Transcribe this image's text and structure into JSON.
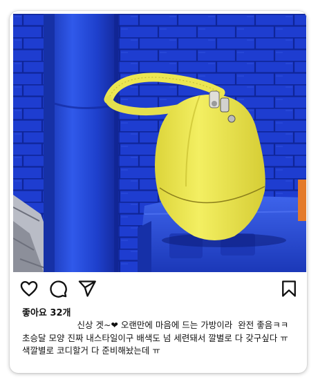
{
  "post": {
    "photo": {
      "alt": "",
      "colors": {
        "wall": "#1e3dd0",
        "bag": "#eeea55",
        "pipe": "#2046d8"
      }
    },
    "actions": {
      "like_icon": "heart-icon",
      "comment_icon": "comment-icon",
      "share_icon": "paper-plane-icon",
      "save_icon": "bookmark-icon"
    },
    "likes_label": "좋아요 32개",
    "caption": "                    신상 겟~❤ 오랜만에 마음에 드는 가방이라  완전 좋음ㅋㅋ\n초승달 모양 진짜 내스타일이구 배색도 넘 세련돼서 깔별로 다 갖구싶다 ㅠ 색깔별로 코디할거 다 준비해놨는데 ㅠ"
  }
}
